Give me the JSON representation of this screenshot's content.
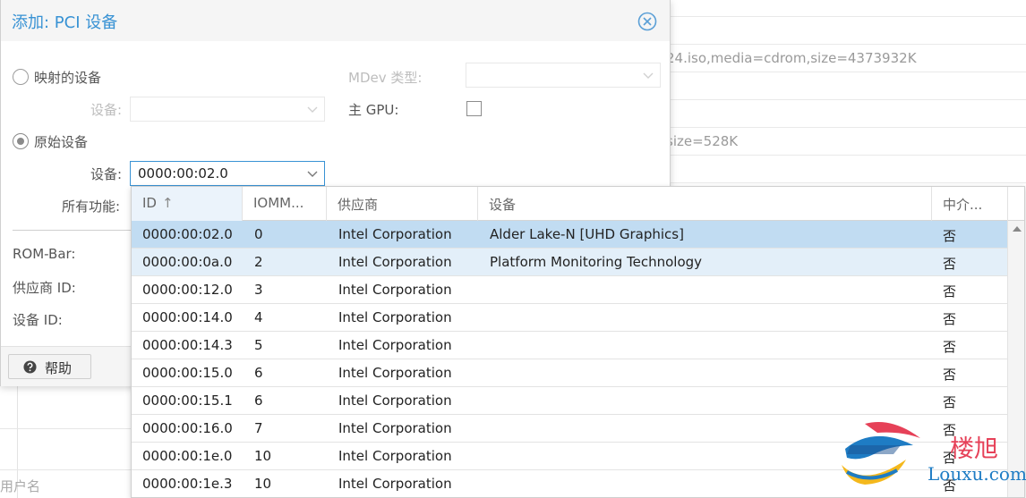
{
  "background": {
    "line1": "24.iso,media=cdrom,size=4373932K",
    "line2": "size=528K",
    "user_label": "用户名"
  },
  "dialog": {
    "title": "添加: PCI 设备",
    "mapped_device_label": "映射的设备",
    "mapped_device_sublabel": "设备:",
    "raw_device_label": "原始设备",
    "device_label": "设备:",
    "device_value": "0000:00:02.0",
    "all_functions_label": "所有功能:",
    "mdev_type_label": "MDev 类型:",
    "main_gpu_label": "主 GPU:",
    "rombar_label": "ROM-Bar:",
    "vendor_id_label": "供应商 ID:",
    "device_id_label": "设备 ID:",
    "help_label": "帮助"
  },
  "grid": {
    "columns": [
      "ID",
      "IOMM...",
      "供应商",
      "设备",
      "中介..."
    ],
    "sort_indicator": "↑",
    "rows": [
      {
        "id": "0000:00:02.0",
        "iommu": "0",
        "vendor": "Intel Corporation",
        "device": "Alder Lake-N [UHD Graphics]",
        "mdev": "否"
      },
      {
        "id": "0000:00:0a.0",
        "iommu": "2",
        "vendor": "Intel Corporation",
        "device": "Platform Monitoring Technology",
        "mdev": "否"
      },
      {
        "id": "0000:00:12.0",
        "iommu": "3",
        "vendor": "Intel Corporation",
        "device": "",
        "mdev": "否"
      },
      {
        "id": "0000:00:14.0",
        "iommu": "4",
        "vendor": "Intel Corporation",
        "device": "",
        "mdev": "否"
      },
      {
        "id": "0000:00:14.3",
        "iommu": "5",
        "vendor": "Intel Corporation",
        "device": "",
        "mdev": "否"
      },
      {
        "id": "0000:00:15.0",
        "iommu": "6",
        "vendor": "Intel Corporation",
        "device": "",
        "mdev": "否"
      },
      {
        "id": "0000:00:15.1",
        "iommu": "6",
        "vendor": "Intel Corporation",
        "device": "",
        "mdev": "否"
      },
      {
        "id": "0000:00:16.0",
        "iommu": "7",
        "vendor": "Intel Corporation",
        "device": "",
        "mdev": "否"
      },
      {
        "id": "0000:00:1e.0",
        "iommu": "10",
        "vendor": "Intel Corporation",
        "device": "",
        "mdev": "否"
      },
      {
        "id": "0000:00:1e.3",
        "iommu": "10",
        "vendor": "Intel Corporation",
        "device": "",
        "mdev": "否"
      }
    ]
  },
  "watermark": {
    "cn": "楼旭",
    "en": "Louxu.com"
  },
  "colors": {
    "accent": "#3892d4",
    "row_selected": "#c1dcf2",
    "row_hover": "#e3eff9",
    "watermark_red": "#e64158",
    "watermark_blue": "#1e7cc4"
  }
}
